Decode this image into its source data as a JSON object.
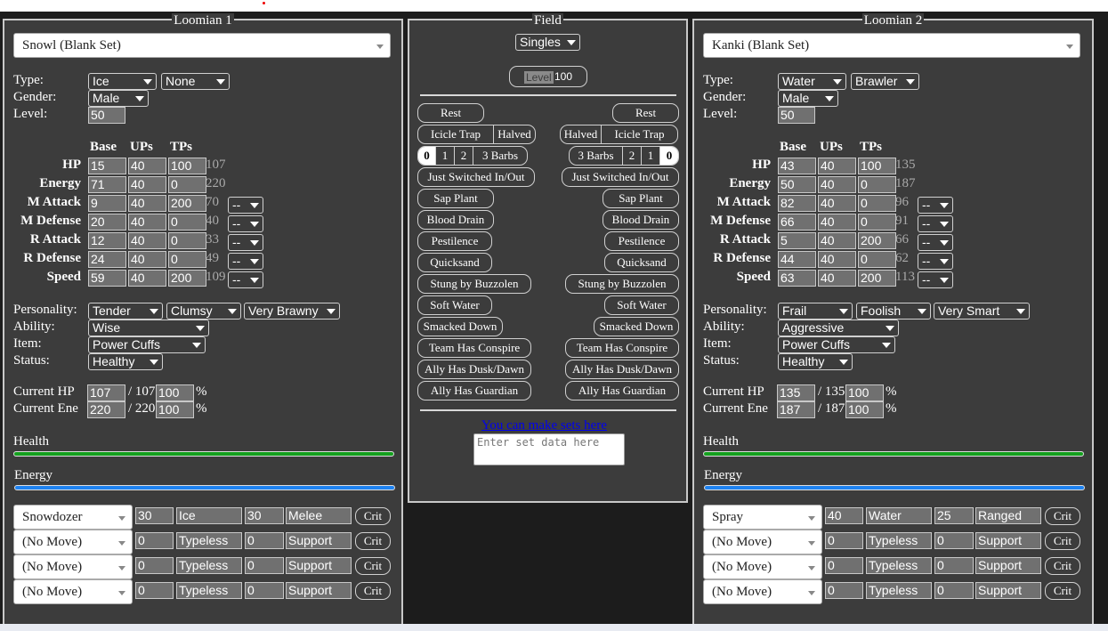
{
  "left": {
    "title": "Loomian 1",
    "set": "Snowl (Blank Set)",
    "labels": {
      "type": "Type:",
      "gender": "Gender:",
      "level": "Level:",
      "base": "Base",
      "ups": "UPs",
      "tps": "TPs",
      "personality": "Personality:",
      "ability": "Ability:",
      "item": "Item:",
      "status": "Status:",
      "cur_hp": "Current HP",
      "cur_ene": "Current Ene",
      "health": "Health",
      "energy": "Energy"
    },
    "type1": "Ice",
    "type2": "None",
    "gender": "Male",
    "level": "50",
    "stats": [
      {
        "name": "HP",
        "base": "15",
        "ups": "40",
        "tps": "100",
        "total": "107",
        "mod": ""
      },
      {
        "name": "Energy",
        "base": "71",
        "ups": "40",
        "tps": "0",
        "total": "220",
        "mod": ""
      },
      {
        "name": "M Attack",
        "base": "9",
        "ups": "40",
        "tps": "200",
        "total": "70",
        "mod": "--"
      },
      {
        "name": "M Defense",
        "base": "20",
        "ups": "40",
        "tps": "0",
        "total": "40",
        "mod": "--"
      },
      {
        "name": "R Attack",
        "base": "12",
        "ups": "40",
        "tps": "0",
        "total": "33",
        "mod": "--"
      },
      {
        "name": "R Defense",
        "base": "24",
        "ups": "40",
        "tps": "0",
        "total": "49",
        "mod": "--"
      },
      {
        "name": "Speed",
        "base": "59",
        "ups": "40",
        "tps": "200",
        "total": "109",
        "mod": "--"
      }
    ],
    "personality": [
      "Tender",
      "Clumsy",
      "Very Brawny"
    ],
    "ability": "Wise",
    "item": "Power Cuffs",
    "status": "Healthy",
    "hp_cur": "107",
    "hp_max": "/ 107",
    "hp_pct": "100",
    "ene_cur": "220",
    "ene_max": "/ 220",
    "ene_pct": "100",
    "pct_sign": "%",
    "health_fraction": 1.0,
    "energy_fraction": 1.0,
    "moves": [
      {
        "name": "Snowdozer",
        "bp": "30",
        "type": "Ice",
        "energy": "30",
        "category": "Melee",
        "crit": "Crit"
      },
      {
        "name": "(No Move)",
        "bp": "0",
        "type": "Typeless",
        "energy": "0",
        "category": "Support",
        "crit": "Crit"
      },
      {
        "name": "(No Move)",
        "bp": "0",
        "type": "Typeless",
        "energy": "0",
        "category": "Support",
        "crit": "Crit"
      },
      {
        "name": "(No Move)",
        "bp": "0",
        "type": "Typeless",
        "energy": "0",
        "category": "Support",
        "crit": "Crit"
      }
    ]
  },
  "right": {
    "title": "Loomian 2",
    "set": "Kanki (Blank Set)",
    "labels": {
      "type": "Type:",
      "gender": "Gender:",
      "level": "Level:",
      "base": "Base",
      "ups": "UPs",
      "tps": "TPs",
      "personality": "Personality:",
      "ability": "Ability:",
      "item": "Item:",
      "status": "Status:",
      "cur_hp": "Current HP",
      "cur_ene": "Current Ene",
      "health": "Health",
      "energy": "Energy"
    },
    "type1": "Water",
    "type2": "Brawler",
    "gender": "Male",
    "level": "50",
    "stats": [
      {
        "name": "HP",
        "base": "43",
        "ups": "40",
        "tps": "100",
        "total": "135",
        "mod": ""
      },
      {
        "name": "Energy",
        "base": "50",
        "ups": "40",
        "tps": "0",
        "total": "187",
        "mod": ""
      },
      {
        "name": "M Attack",
        "base": "82",
        "ups": "40",
        "tps": "0",
        "total": "96",
        "mod": "--"
      },
      {
        "name": "M Defense",
        "base": "66",
        "ups": "40",
        "tps": "0",
        "total": "91",
        "mod": "--"
      },
      {
        "name": "R Attack",
        "base": "5",
        "ups": "40",
        "tps": "200",
        "total": "66",
        "mod": "--"
      },
      {
        "name": "R Defense",
        "base": "44",
        "ups": "40",
        "tps": "0",
        "total": "62",
        "mod": "--"
      },
      {
        "name": "Speed",
        "base": "63",
        "ups": "40",
        "tps": "200",
        "total": "113",
        "mod": "--"
      }
    ],
    "personality": [
      "Frail",
      "Foolish",
      "Very Smart"
    ],
    "ability": "Aggressive",
    "item": "Power Cuffs",
    "status": "Healthy",
    "hp_cur": "135",
    "hp_max": "/ 135",
    "hp_pct": "100",
    "ene_cur": "187",
    "ene_max": "/ 187",
    "ene_pct": "100",
    "pct_sign": "%",
    "health_fraction": 1.0,
    "energy_fraction": 1.0,
    "moves": [
      {
        "name": "Spray",
        "bp": "40",
        "type": "Water",
        "energy": "25",
        "category": "Ranged",
        "crit": "Crit"
      },
      {
        "name": "(No Move)",
        "bp": "0",
        "type": "Typeless",
        "energy": "0",
        "category": "Support",
        "crit": "Crit"
      },
      {
        "name": "(No Move)",
        "bp": "0",
        "type": "Typeless",
        "energy": "0",
        "category": "Support",
        "crit": "Crit"
      },
      {
        "name": "(No Move)",
        "bp": "0",
        "type": "Typeless",
        "energy": "0",
        "category": "Support",
        "crit": "Crit"
      }
    ]
  },
  "field": {
    "title": "Field",
    "format": "Singles",
    "level_placeholder": "Level",
    "level_value": "100",
    "rest": "Rest",
    "icicle_trap": "Icicle Trap",
    "halved": "Halved",
    "barbs": [
      "0",
      "1",
      "2",
      "3 Barbs"
    ],
    "barbs_selected": "0",
    "toggles": [
      "Just Switched In/Out",
      "Sap Plant",
      "Blood Drain",
      "Pestilence",
      "Quicksand",
      "Stung by Buzzolen",
      "Soft Water",
      "Smacked Down",
      "Team Has Conspire",
      "Ally Has Dusk/Dawn",
      "Ally Has Guardian"
    ],
    "sets_link": "You can make sets here",
    "set_placeholder": "Enter set data here"
  },
  "colors": {
    "panel": "#3c3c3c",
    "health": "#14a01e",
    "energy": "#1e82f0",
    "link": "#0000ee"
  }
}
